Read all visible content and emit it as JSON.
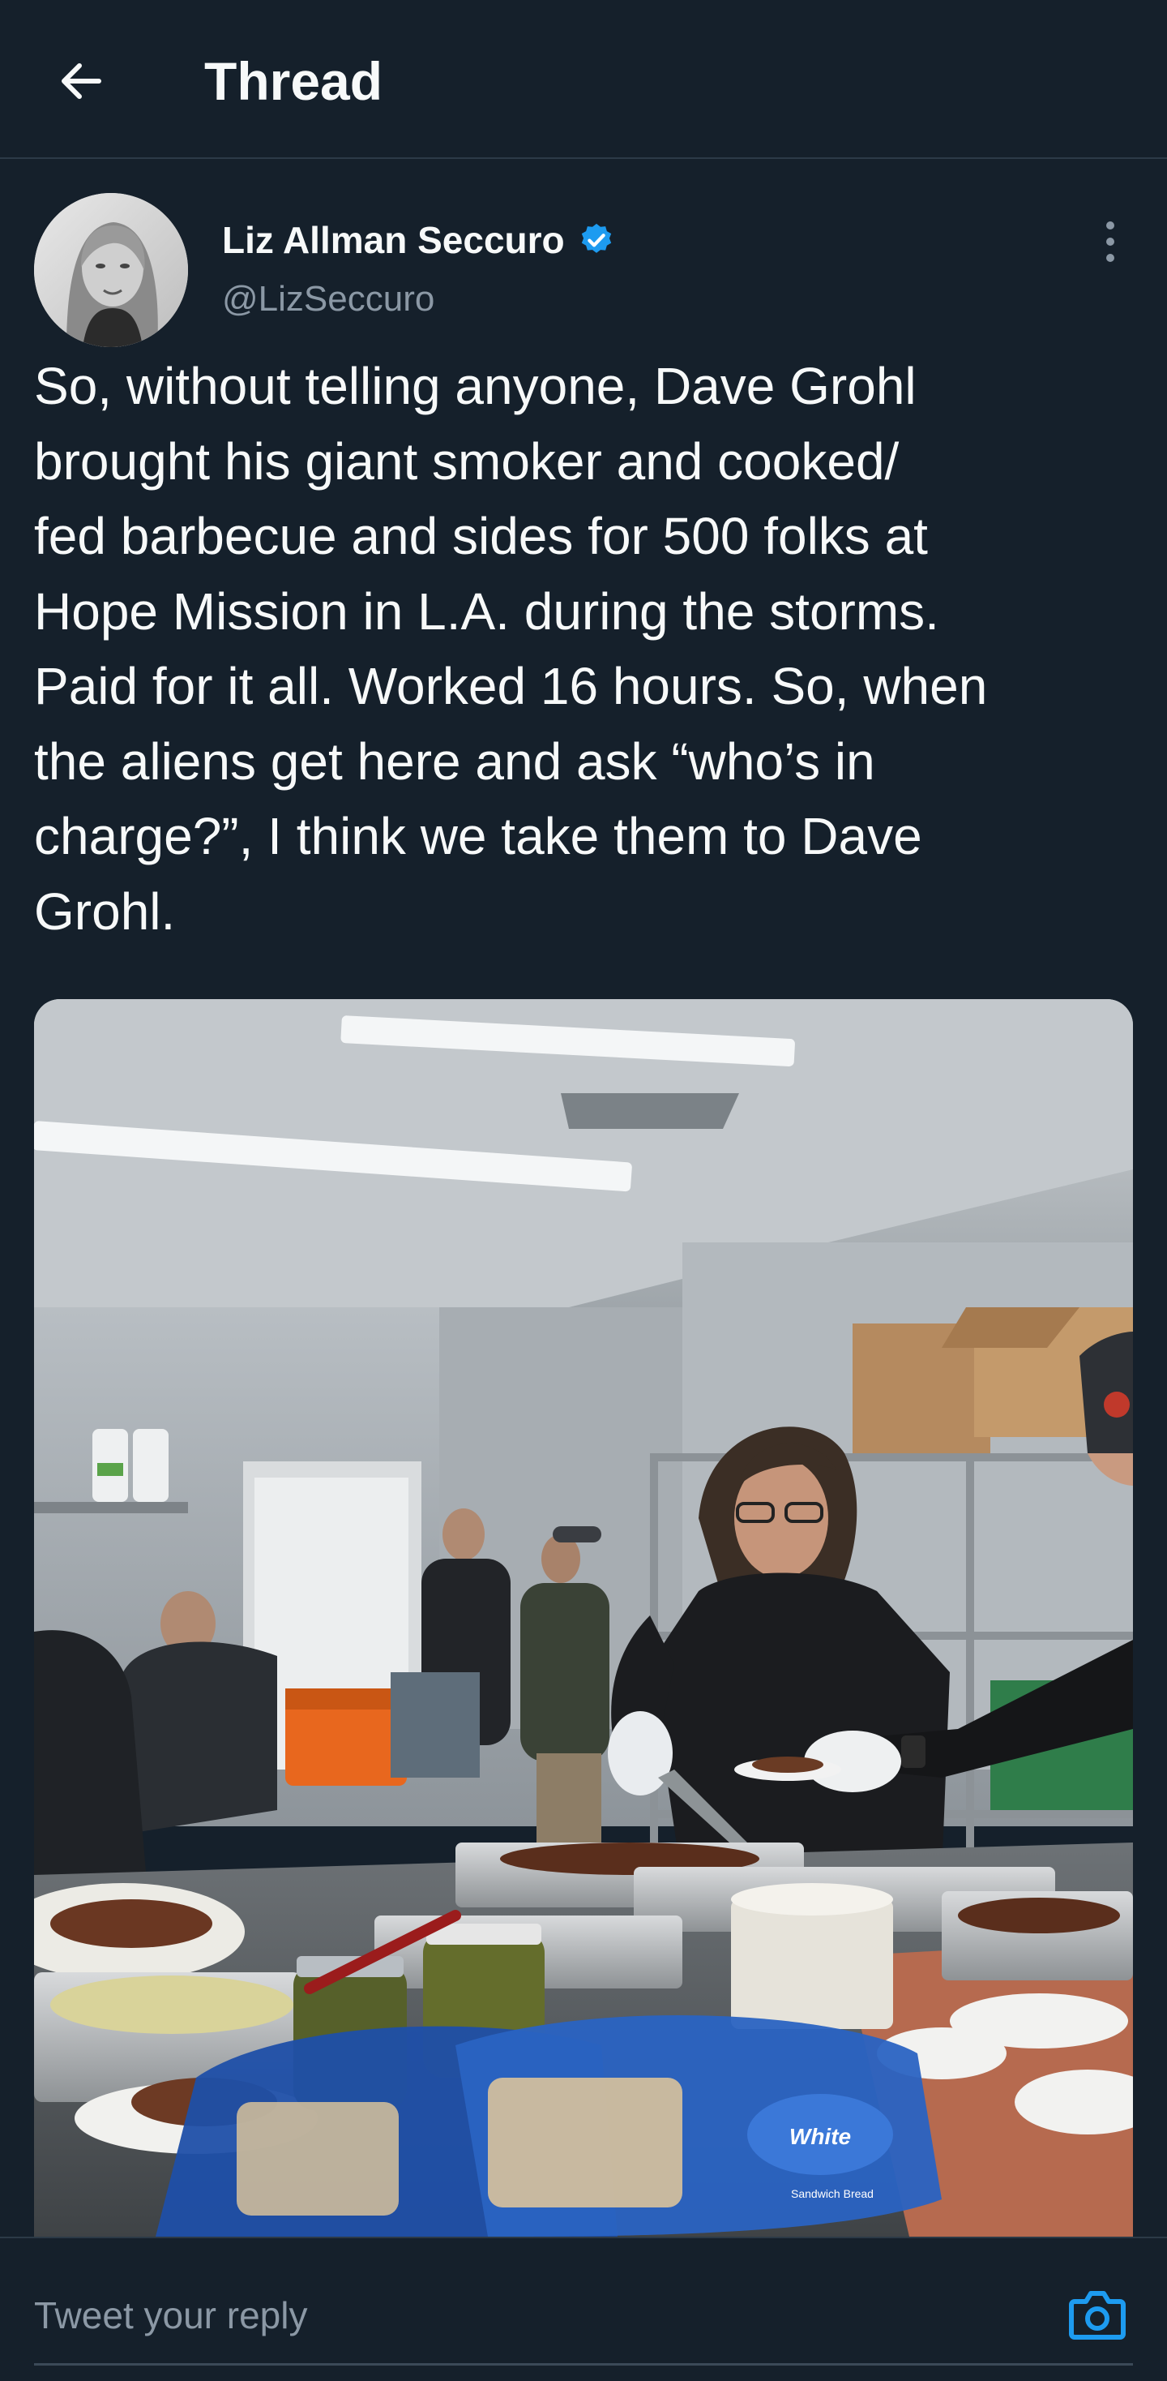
{
  "header": {
    "title": "Thread",
    "back_icon": "arrow-left-icon"
  },
  "tweet": {
    "author": {
      "display_name": "Liz Allman Seccuro",
      "handle": "@LizSeccuro",
      "verified": true,
      "verified_color": "#1d9bf0"
    },
    "text": "So, without telling anyone, Dave Grohl\nbrought his giant smoker and cooked/\nfed barbecue and sides for 500 folks at\nHope Mission in L.A. during the storms.\nPaid for it all.  Worked 16 hours. So, when\nthe aliens get here and ask “who’s in\ncharge?”, I think we take them to Dave\nGrohl.",
    "media": {
      "bread_label": "White",
      "bread_sublabel": "Sandwich Bread"
    }
  },
  "reply": {
    "placeholder": "Tweet your reply",
    "camera_icon": "camera-icon",
    "accent": "#1d9bf0"
  },
  "colors": {
    "background": "#15202b",
    "text": "#f7f9f9",
    "secondary": "#8b98a5"
  }
}
